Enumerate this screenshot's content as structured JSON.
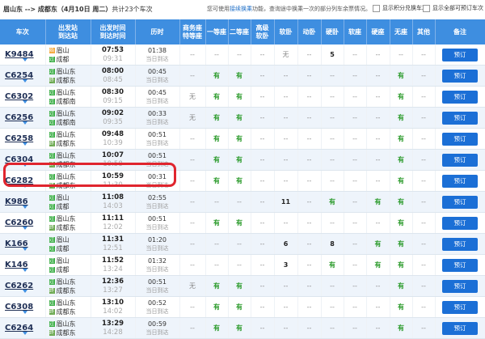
{
  "header": {
    "route": "眉山东 --> 成都东（4月10日 周二）",
    "count": "共计23个车次",
    "tip_pre": "您可使用",
    "tip_link": "接续换乘",
    "tip_post": "功能，查询途中换乘一次的部分列车余票情况。",
    "opt1": "显示积分兑换车次",
    "opt2": "显示全部可预订车次"
  },
  "columns": [
    "车次",
    "出发站\n到达站",
    "出发时间\n到达时间",
    "历时",
    "商务座\n特等座",
    "一等座",
    "二等座",
    "高级\n软卧",
    "软卧",
    "动卧",
    "硬卧",
    "软座",
    "硬座",
    "无座",
    "其他",
    "备注"
  ],
  "book_label": "预订",
  "rows": [
    {
      "train": "K9484",
      "from": "眉山",
      "to": "成都",
      "fb": "始",
      "tb": "过",
      "dep": "07:53",
      "arr": "09:31",
      "dur": "01:38",
      "day": "当日到达",
      "seats": [
        "--",
        "--",
        "--",
        "--",
        "无",
        "--",
        "5",
        "--",
        "--",
        "--",
        "--"
      ]
    },
    {
      "train": "C6254",
      "from": "眉山东",
      "to": "成都东",
      "fb": "过",
      "tb": "终",
      "dep": "08:00",
      "arr": "08:45",
      "dur": "00:45",
      "day": "当日到达",
      "seats": [
        "--",
        "有",
        "有",
        "--",
        "--",
        "--",
        "--",
        "--",
        "--",
        "有",
        "--"
      ]
    },
    {
      "train": "C6302",
      "from": "眉山东",
      "to": "成都南",
      "fb": "过",
      "tb": "过",
      "dep": "08:30",
      "arr": "09:15",
      "dur": "00:45",
      "day": "当日到达",
      "seats": [
        "无",
        "有",
        "有",
        "--",
        "--",
        "--",
        "--",
        "--",
        "--",
        "有",
        "--"
      ]
    },
    {
      "train": "C6256",
      "from": "眉山东",
      "to": "成都南",
      "fb": "过",
      "tb": "过",
      "dep": "09:02",
      "arr": "09:35",
      "dur": "00:33",
      "day": "当日到达",
      "seats": [
        "无",
        "有",
        "有",
        "--",
        "--",
        "--",
        "--",
        "--",
        "--",
        "有",
        "--"
      ]
    },
    {
      "train": "C6258",
      "from": "眉山东",
      "to": "成都东",
      "fb": "过",
      "tb": "终",
      "dep": "09:48",
      "arr": "10:39",
      "dur": "00:51",
      "day": "当日到达",
      "seats": [
        "--",
        "有",
        "有",
        "--",
        "--",
        "--",
        "--",
        "--",
        "--",
        "有",
        "--"
      ]
    },
    {
      "train": "C6304",
      "from": "眉山东",
      "to": "成都东",
      "fb": "过",
      "tb": "终",
      "dep": "10:07",
      "arr": "10:58",
      "dur": "00:51",
      "day": "当日到达",
      "seats": [
        "--",
        "有",
        "有",
        "--",
        "--",
        "--",
        "--",
        "--",
        "--",
        "有",
        "--"
      ]
    },
    {
      "train": "C6282",
      "from": "眉山东",
      "to": "成都东",
      "fb": "过",
      "tb": "终",
      "dep": "10:59",
      "arr": "11:30",
      "dur": "00:31",
      "day": "当日到达",
      "seats": [
        "--",
        "有",
        "有",
        "--",
        "--",
        "--",
        "--",
        "--",
        "--",
        "有",
        "--"
      ]
    },
    {
      "train": "K986",
      "from": "眉山",
      "to": "成都",
      "fb": "过",
      "tb": "过",
      "dep": "11:08",
      "arr": "14:03",
      "dur": "02:55",
      "day": "当日到达",
      "seats": [
        "--",
        "--",
        "--",
        "--",
        "11",
        "--",
        "有",
        "--",
        "有",
        "有",
        "--"
      ]
    },
    {
      "train": "C6260",
      "from": "眉山东",
      "to": "成都东",
      "fb": "过",
      "tb": "终",
      "dep": "11:11",
      "arr": "12:02",
      "dur": "00:51",
      "day": "当日到达",
      "seats": [
        "--",
        "有",
        "有",
        "--",
        "--",
        "--",
        "--",
        "--",
        "--",
        "有",
        "--"
      ]
    },
    {
      "train": "K166",
      "from": "眉山",
      "to": "成都",
      "fb": "过",
      "tb": "过",
      "dep": "11:31",
      "arr": "12:51",
      "dur": "01:20",
      "day": "当日到达",
      "seats": [
        "--",
        "--",
        "--",
        "--",
        "6",
        "--",
        "8",
        "--",
        "有",
        "有",
        "--"
      ]
    },
    {
      "train": "K146",
      "from": "眉山",
      "to": "成都",
      "fb": "过",
      "tb": "过",
      "dep": "11:52",
      "arr": "13:24",
      "dur": "01:32",
      "day": "当日到达",
      "seats": [
        "--",
        "--",
        "--",
        "--",
        "3",
        "--",
        "有",
        "--",
        "有",
        "有",
        "--"
      ]
    },
    {
      "train": "C6262",
      "from": "眉山东",
      "to": "成都东",
      "fb": "过",
      "tb": "终",
      "dep": "12:36",
      "arr": "13:27",
      "dur": "00:51",
      "day": "当日到达",
      "seats": [
        "无",
        "有",
        "有",
        "--",
        "--",
        "--",
        "--",
        "--",
        "--",
        "有",
        "--"
      ]
    },
    {
      "train": "C6308",
      "from": "眉山东",
      "to": "成都东",
      "fb": "过",
      "tb": "终",
      "dep": "13:10",
      "arr": "14:02",
      "dur": "00:52",
      "day": "当日到达",
      "seats": [
        "--",
        "有",
        "有",
        "--",
        "--",
        "--",
        "--",
        "--",
        "--",
        "有",
        "--"
      ]
    },
    {
      "train": "C6264",
      "from": "眉山东",
      "to": "成都东",
      "fb": "过",
      "tb": "终",
      "dep": "13:29",
      "arr": "14:28",
      "dur": "00:59",
      "day": "当日到达",
      "seats": [
        "--",
        "有",
        "有",
        "--",
        "--",
        "--",
        "--",
        "--",
        "--",
        "有",
        "--"
      ]
    }
  ],
  "colors": {
    "header_bg": "#3e8ee0",
    "book_btn": "#1b6fd6",
    "available": "#2a9a2a",
    "highlight_ring": "#e0252e",
    "alt_row": "#eef4fb"
  }
}
